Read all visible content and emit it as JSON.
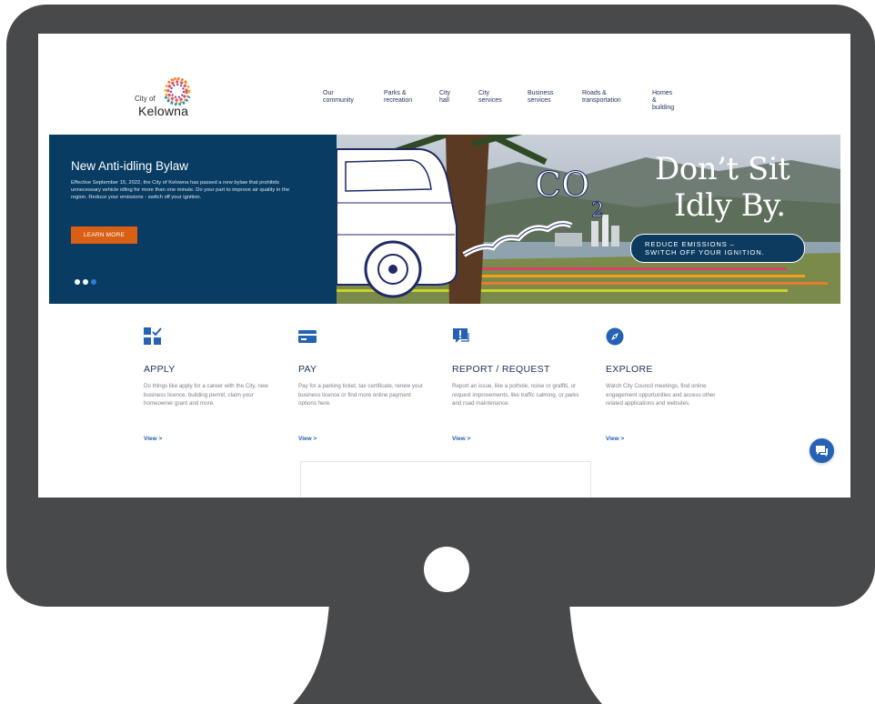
{
  "brand": {
    "city_of": "City of",
    "name": "Kelowna"
  },
  "nav": {
    "items": [
      "Our\ncommunity",
      "Parks &\nrecreation",
      "City\nhall",
      "City\nservices",
      "Business\nservices",
      "Roads &\ntransportation",
      "Homes &\nbuilding"
    ]
  },
  "hero": {
    "title": "New Anti-idling Bylaw",
    "text": "Effective September 15, 2022, the City of Kelowna has passed a new bylaw that prohibits unnecessary vehicle idling for more than one minute. Do your part to improve air quality in the region. Reduce your emissions - switch off your ignition.",
    "button_label": "LEARN MORE",
    "dots": {
      "count": 3,
      "active_index": 2
    },
    "image": {
      "headline_line1": "Don’t Sit",
      "headline_line2": "Idly By.",
      "pill_text": "REDUCE EMISSIONS –\nSWITCH OFF YOUR IGNITION.",
      "co2_label": "CO",
      "co2_sub": "2"
    }
  },
  "cards": [
    {
      "icon": "apply-grid-check-icon",
      "title": "APPLY",
      "text": "Do things like apply for a career with the City, new business licence, building permit, claim your homeowner grant and more.",
      "link": "View >"
    },
    {
      "icon": "payment-card-icon",
      "title": "PAY",
      "text": "Pay for a parking ticket, tax certificate, renew your business licence or find more online payment options here.",
      "link": "View >"
    },
    {
      "icon": "report-alert-bubble-icon",
      "title": "REPORT / REQUEST",
      "text": "Report an issue, like a pothole, noise or graffiti, or request improvements, like traffic calming, or parks and road maintenance.",
      "link": "View >"
    },
    {
      "icon": "compass-icon",
      "title": "EXPLORE",
      "text": "Watch City Council meetings, find online engagement opportunities and access other related applications and websites.",
      "link": "View >"
    }
  ],
  "colors": {
    "navy": "#083c62",
    "nav_text": "#23325f",
    "accent_orange": "#d95f14",
    "link_blue": "#1f5fae",
    "chat_blue": "#2562b5",
    "monitor": "#48494b"
  }
}
